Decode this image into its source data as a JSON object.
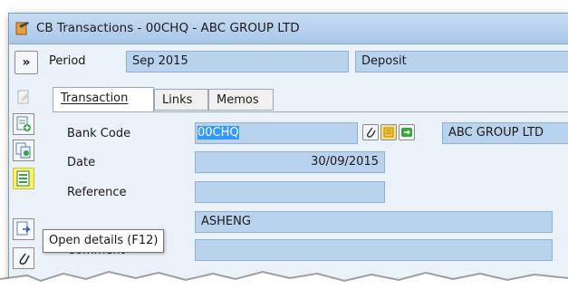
{
  "window": {
    "title": "CB Transactions - 00CHQ - ABC GROUP LTD"
  },
  "header": {
    "expand_label": "»",
    "period_label": "Period",
    "period_value": "Sep 2015",
    "type_value": "Deposit"
  },
  "tabs": [
    {
      "label": "Transaction",
      "active": true
    },
    {
      "label": "Links",
      "active": false
    },
    {
      "label": "Memos",
      "active": false
    }
  ],
  "form": {
    "bank_code_label": "Bank Code",
    "bank_code_value": "00CHQ",
    "bank_name_value": "ABC GROUP LTD",
    "date_label": "Date",
    "date_value": "30/09/2015",
    "reference_label": "Reference",
    "reference_value": "",
    "payee_value": "ASHENG",
    "comment_label": "Comment"
  },
  "tooltip": {
    "text": "Open details (F12)"
  },
  "icons": {
    "side_buttons": [
      "edit-disabled-icon",
      "add-document-icon",
      "copy-document-icon",
      "open-details-icon",
      "details-icon",
      "attachment-icon"
    ],
    "lookup_buttons": [
      "paperclip-icon",
      "note-icon",
      "green-arrow-icon"
    ]
  },
  "colors": {
    "field_bg": "#b9d3ef",
    "title_bg": "#b8d1ec",
    "highlight": "#f7f36a"
  }
}
